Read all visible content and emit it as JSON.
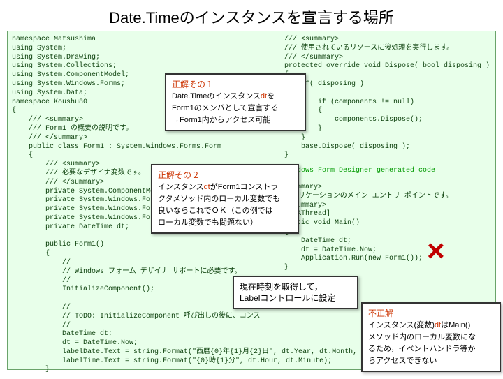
{
  "title": "Date.Timeのインスタンスを宣言する場所",
  "code_left": "namespace Matsushima\nusing System;\nusing System.Drawing;\nusing System.Collections;\nusing System.ComponentModel;\nusing System.Windows.Forms;\nusing System.Data;\nnamespace Koushu80\n{\n    /// <summary>\n    /// Form1 の概要の説明です。\n    /// </summary>\n    public class Form1 : System.Windows.Forms.Form\n    {\n        /// <summary>\n        /// 必要なデザイナ変数です。\n        /// </summary>\n        private System.ComponentModel.Container\n        private System.Windows.Forms.Label\n        private System.Windows.Forms.Label\n        private System.Windows.Forms.Button\n        private DateTime dt;\n\n        public Form1()\n        {\n            //\n            // Windows フォーム デザイナ サポートに必要です。\n            //\n            InitializeComponent();\n\n            //\n            // TODO: InitializeComponent 呼び出しの後に、コンス\n            //\n            DateTime dt;\n            dt = DateTime.Now;\n            labelDate.Text = string.Format(\"西暦{0}年{1}月{2}日\", dt.Year, dt.Month, dt.Day);\n            labelTime.Text = string.Format(\"{0}時{1}分\", dt.Hour, dt.Minute);\n        }",
  "code_right": "/// <summary>\n/// 使用されているリソースに後処理を実行します。\n/// </summary>\nprotected override void Dispose( bool disposing )\n{\n    if( disposing )\n    {\n        if (components != null)\n        {\n            components.Dispose();\n        }\n    }\n    base.Dispose( disposing );\n}\n",
  "designer_region": "Windows Form Designer generated code",
  "code_main_top": "<summary>\nアプリケーションのメイン エントリ ポイントです。\n</summary>\n[STAThread]\nstatic void Main()\n{\n    DateTime dt;\n    dt = DateTime.Now;\n    Application.Run(new Form1());\n}",
  "callout1": {
    "head": "正解その１",
    "body1a": "Date.Timeのインスタンス",
    "body1b": "dt",
    "body1c": "を",
    "body2": "Form1のメンバとして宣言する",
    "body3": "→Form1内からアクセス可能"
  },
  "callout2": {
    "head": "正解その２",
    "body1a": "インスタンス",
    "body1b": "dt",
    "body1c": "がForm1コンストラ",
    "body2": "クタメソッド内のローカル変数でも",
    "body3": "良いならこれでＯＫ（この例では",
    "body4": "ローカル変数でも問題ない）"
  },
  "callout3": {
    "line1": "現在時刻を取得して，",
    "line2": "Labelコントロールに設定"
  },
  "callout4": {
    "head": "不正解",
    "body1a": "インスタンス(変数)",
    "body1b": "dt",
    "body1c": "はMain()",
    "body2": "メソッド内のローカル変数にな",
    "body3": "るため，イベントハンドラ等か",
    "body4": "らアクセスできない"
  },
  "x_mark": "×"
}
